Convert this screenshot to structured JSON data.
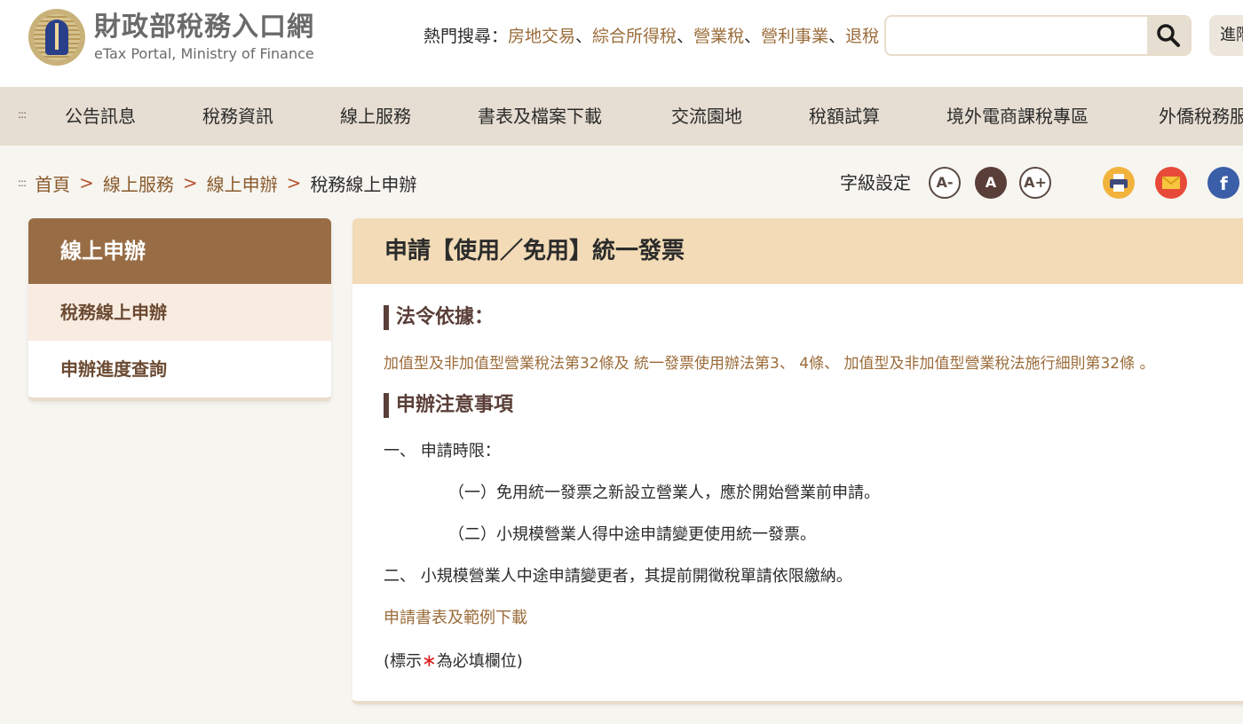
{
  "header": {
    "logo_title": "財政部稅務入口網",
    "logo_subtitle": "eTax Portal, Ministry of Finance",
    "hot_label": "熱門搜尋：",
    "hot_terms": [
      "房地交易",
      "綜合所得稅",
      "營業稅",
      "營利事業",
      "退稅"
    ],
    "search_placeholder": "",
    "advanced_label": "進階"
  },
  "nav": {
    "items": [
      "公告訊息",
      "稅務資訊",
      "線上服務",
      "書表及檔案下載",
      "交流園地",
      "稅額試算",
      "境外電商課稅專區",
      "外僑稅務服"
    ]
  },
  "breadcrumb": {
    "items": [
      "首頁",
      "線上服務",
      "線上申辦"
    ],
    "current": "稅務線上申辦"
  },
  "font_setting": {
    "label": "字級設定",
    "small": "A-",
    "normal": "A",
    "large": "A+"
  },
  "sidebar": {
    "title": "線上申辦",
    "items": [
      "稅務線上申辦",
      "申辦進度查詢"
    ]
  },
  "main": {
    "title": "申請【使用／免用】統一發票",
    "law_title": "法令依據：",
    "law_text": "加值型及非加值型營業稅法第32條及 統一發票使用辦法第3、 4條、 加值型及非加值型營業稅法施行細則第32條 。",
    "notes_title": "申辦注意事項",
    "item1": "一、 申請時限：",
    "item1_sub1": "（一）免用統一發票之新設立營業人，應於開始營業前申請。",
    "item1_sub2": "（二）小規模營業人得中途申請變更使用統一發票。",
    "item2": "二、 小規模營業人中途申請變更者，其提前開徵稅單請依限繳納。",
    "download_link": "申請書表及範例下載",
    "required_prefix": "(標示",
    "required_star": "∗",
    "required_suffix": "為必填欄位)"
  },
  "colors": {
    "accent_brown": "#986d46",
    "link_brown": "#9b6c3a",
    "title_bg": "#f2dbb6",
    "nav_bg": "#e6ded2"
  }
}
